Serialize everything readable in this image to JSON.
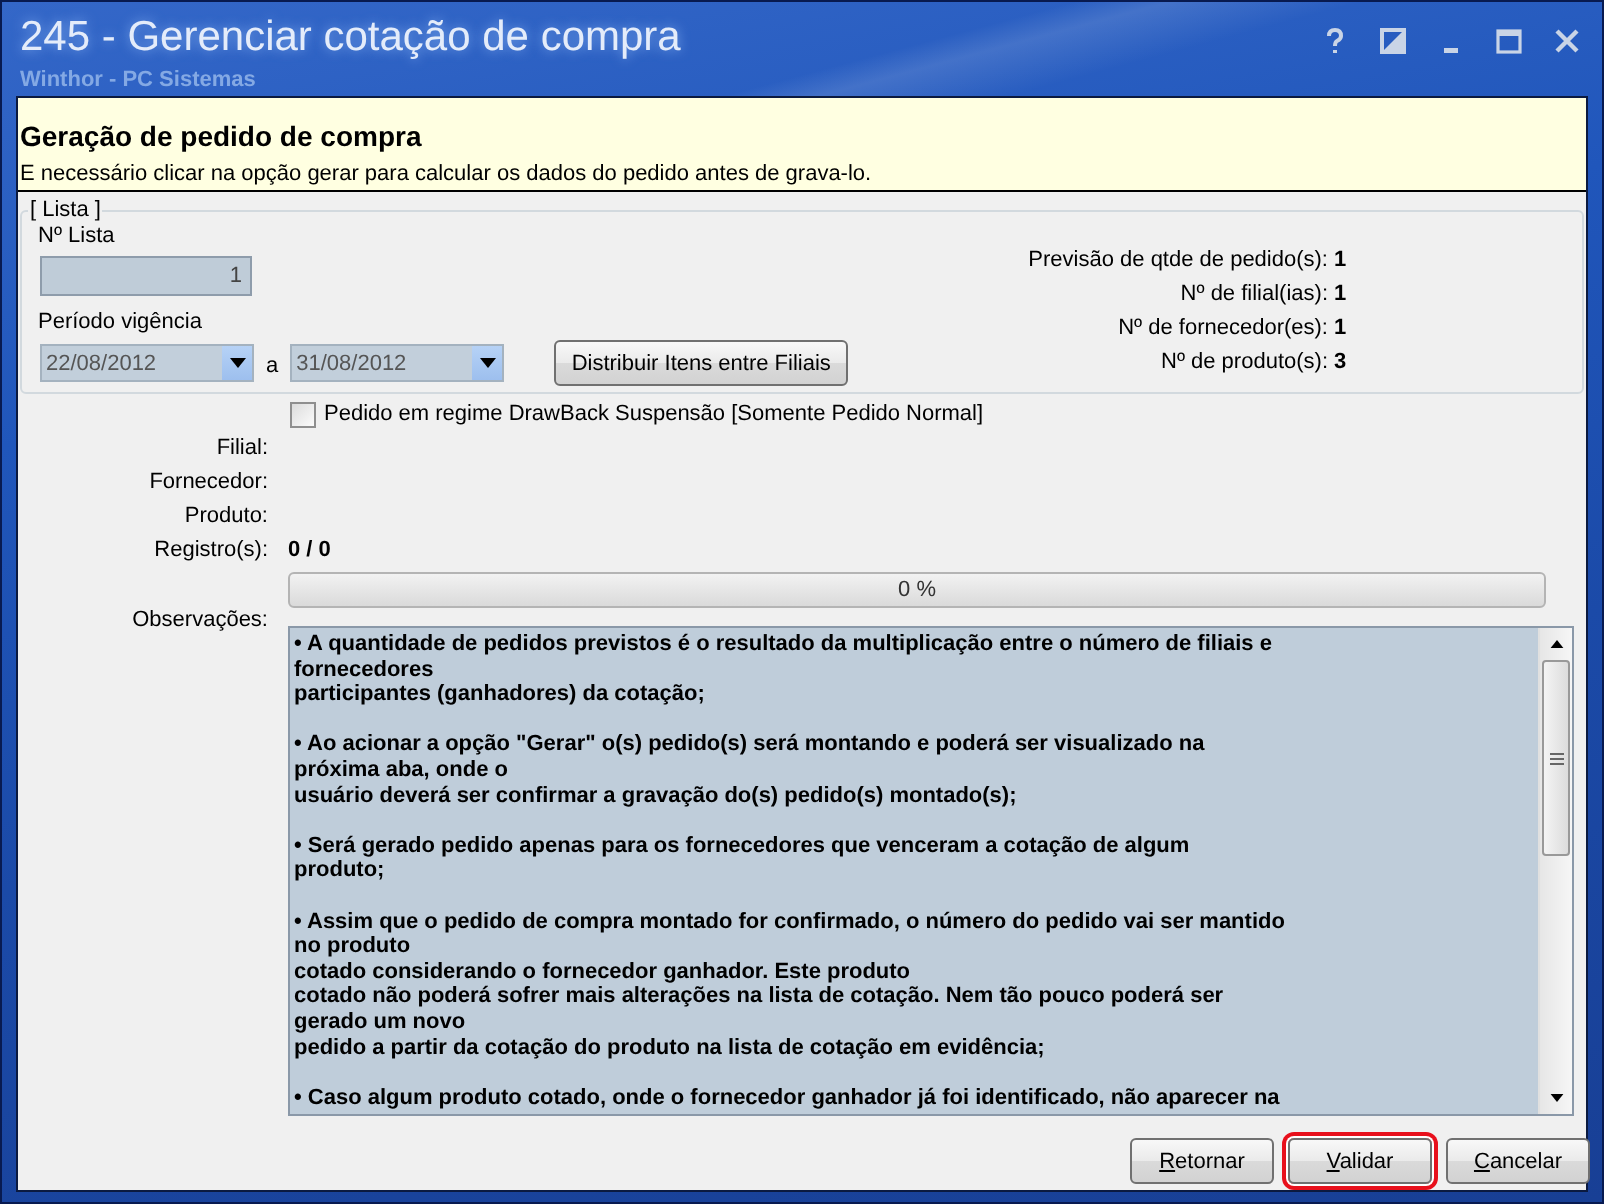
{
  "window": {
    "title": "245 - Gerenciar cotação de compra",
    "subtitle": "Winthor - PC Sistemas"
  },
  "header": {
    "title": "Geração de pedido de compra",
    "description": "E necessário clicar na opção gerar para calcular os dados do pedido antes de grava-lo."
  },
  "lista": {
    "legend": "[ Lista ]",
    "number_label": "Nº Lista",
    "number_value": "1",
    "period_label": "Período vigência",
    "date_from": "22/08/2012",
    "separator": "a",
    "date_to": "31/08/2012",
    "distribute_button": "Distribuir Itens entre Filiais"
  },
  "summary": [
    {
      "label": "Previsão de qtde de pedido(s):",
      "value": "1"
    },
    {
      "label": "Nº de filial(ias):",
      "value": "1"
    },
    {
      "label": "Nº de fornecedor(es):",
      "value": "1"
    },
    {
      "label": "Nº de produto(s):",
      "value": "3"
    }
  ],
  "drawback": {
    "label": "Pedido em regime DrawBack Suspensão [Somente Pedido Normal]",
    "checked": false
  },
  "details": [
    {
      "label": "Filial:"
    },
    {
      "label": "Fornecedor:"
    },
    {
      "label": "Produto:"
    },
    {
      "label": "Registro(s):",
      "value": "0 / 0"
    }
  ],
  "progress": {
    "level": 0,
    "reading": "0 %"
  },
  "observations": {
    "label": "Observações:",
    "paragraphs": [
      "• A quantidade de pedidos previstos é o resultado da multiplicação entre o número de filiais e\nfornecedores\nparticipantes (ganhadores) da cotação;",
      "• Ao acionar a opção \"Gerar\" o(s) pedido(s) será montando e poderá ser visualizado na\npróxima aba, onde o\nusuário deverá ser confirmar a gravação do(s) pedido(s) montado(s);",
      "• Será gerado pedido apenas para os fornecedores que venceram a cotação de algum\nproduto;",
      "• Assim que o pedido de compra montado for confirmado, o número do pedido vai ser mantido\nno produto\ncotado considerando o fornecedor ganhador. Este produto\ncotado não poderá sofrer mais alterações na lista de cotação. Nem tão pouco poderá ser\ngerado um novo\npedido a partir da cotação do produto na lista de cotação em evidência;",
      "• Caso algum produto cotado, onde o fornecedor ganhador já foi identificado, não aparecer na"
    ]
  },
  "buttons": [
    {
      "label": "Retornar",
      "highlighted": false
    },
    {
      "label": "Validar",
      "highlighted": true
    },
    {
      "label": "Cancelar",
      "highlighted": false
    }
  ]
}
